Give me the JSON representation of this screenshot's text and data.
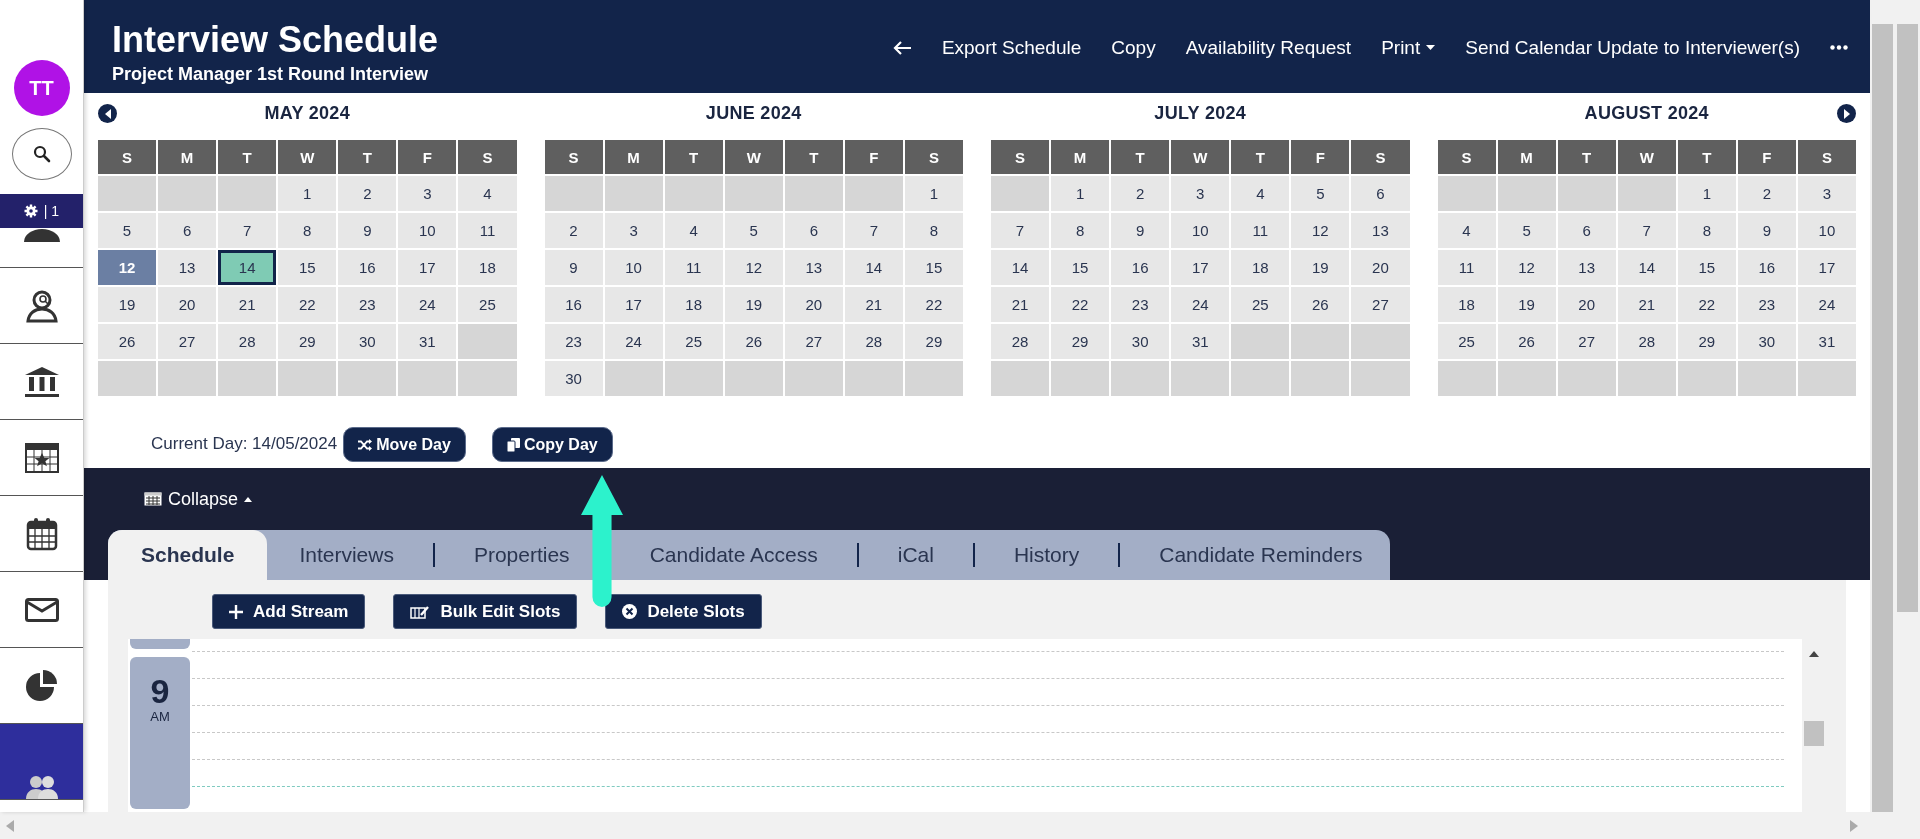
{
  "sidebar": {
    "avatar": "TT",
    "badge": "| 1",
    "items": [
      {
        "selected": false
      },
      {
        "selected": false
      },
      {
        "selected": false
      },
      {
        "selected": false
      },
      {
        "selected": false
      },
      {
        "selected": false
      },
      {
        "selected": false
      },
      {
        "selected": true
      }
    ]
  },
  "header": {
    "title": "Interview Schedule",
    "subtitle": "Project Manager 1st Round Interview",
    "actions": [
      {
        "kind": "back"
      },
      {
        "kind": "link",
        "label": "Export Schedule"
      },
      {
        "kind": "link",
        "label": "Copy"
      },
      {
        "kind": "link",
        "label": "Availability Request"
      },
      {
        "kind": "dropdown",
        "label": "Print"
      },
      {
        "kind": "link",
        "label": "Send Calendar Update to Interviewer(s)"
      },
      {
        "kind": "more"
      }
    ]
  },
  "calendar": {
    "months": [
      {
        "title": "MAY 2024",
        "weekdays": [
          "S",
          "M",
          "T",
          "W",
          "T",
          "F",
          "S"
        ],
        "weeks": [
          [
            {
              "kind": "blank"
            },
            {
              "kind": "blank"
            },
            {
              "kind": "blank"
            },
            {
              "kind": "day",
              "day": "1",
              "selected": false,
              "today": false
            },
            {
              "kind": "day",
              "day": "2",
              "selected": false,
              "today": false
            },
            {
              "kind": "day",
              "day": "3",
              "selected": false,
              "today": false
            },
            {
              "kind": "day",
              "day": "4",
              "selected": false,
              "today": false
            }
          ],
          [
            {
              "kind": "day",
              "day": "5",
              "selected": false,
              "today": false
            },
            {
              "kind": "day",
              "day": "6",
              "selected": false,
              "today": false
            },
            {
              "kind": "day",
              "day": "7",
              "selected": false,
              "today": false
            },
            {
              "kind": "day",
              "day": "8",
              "selected": false,
              "today": false
            },
            {
              "kind": "day",
              "day": "9",
              "selected": false,
              "today": false
            },
            {
              "kind": "day",
              "day": "10",
              "selected": false,
              "today": false
            },
            {
              "kind": "day",
              "day": "11",
              "selected": false,
              "today": false
            }
          ],
          [
            {
              "kind": "day",
              "day": "12",
              "selected": false,
              "today": true
            },
            {
              "kind": "day",
              "day": "13",
              "selected": false,
              "today": false
            },
            {
              "kind": "day",
              "day": "14",
              "selected": true,
              "today": false
            },
            {
              "kind": "day",
              "day": "15",
              "selected": false,
              "today": false
            },
            {
              "kind": "day",
              "day": "16",
              "selected": false,
              "today": false
            },
            {
              "kind": "day",
              "day": "17",
              "selected": false,
              "today": false
            },
            {
              "kind": "day",
              "day": "18",
              "selected": false,
              "today": false
            }
          ],
          [
            {
              "kind": "day",
              "day": "19",
              "selected": false,
              "today": false
            },
            {
              "kind": "day",
              "day": "20",
              "selected": false,
              "today": false
            },
            {
              "kind": "day",
              "day": "21",
              "selected": false,
              "today": false
            },
            {
              "kind": "day",
              "day": "22",
              "selected": false,
              "today": false
            },
            {
              "kind": "day",
              "day": "23",
              "selected": false,
              "today": false
            },
            {
              "kind": "day",
              "day": "24",
              "selected": false,
              "today": false
            },
            {
              "kind": "day",
              "day": "25",
              "selected": false,
              "today": false
            }
          ],
          [
            {
              "kind": "day",
              "day": "26",
              "selected": false,
              "today": false
            },
            {
              "kind": "day",
              "day": "27",
              "selected": false,
              "today": false
            },
            {
              "kind": "day",
              "day": "28",
              "selected": false,
              "today": false
            },
            {
              "kind": "day",
              "day": "29",
              "selected": false,
              "today": false
            },
            {
              "kind": "day",
              "day": "30",
              "selected": false,
              "today": false
            },
            {
              "kind": "day",
              "day": "31",
              "selected": false,
              "today": false
            },
            {
              "kind": "blank"
            }
          ],
          [
            {
              "kind": "blank"
            },
            {
              "kind": "blank"
            },
            {
              "kind": "blank"
            },
            {
              "kind": "blank"
            },
            {
              "kind": "blank"
            },
            {
              "kind": "blank"
            },
            {
              "kind": "blank"
            }
          ]
        ]
      },
      {
        "title": "JUNE 2024",
        "weekdays": [
          "S",
          "M",
          "T",
          "W",
          "T",
          "F",
          "S"
        ],
        "weeks": [
          [
            {
              "kind": "blank"
            },
            {
              "kind": "blank"
            },
            {
              "kind": "blank"
            },
            {
              "kind": "blank"
            },
            {
              "kind": "blank"
            },
            {
              "kind": "blank"
            },
            {
              "kind": "day",
              "day": "1",
              "selected": false,
              "today": false
            }
          ],
          [
            {
              "kind": "day",
              "day": "2",
              "selected": false,
              "today": false
            },
            {
              "kind": "day",
              "day": "3",
              "selected": false,
              "today": false
            },
            {
              "kind": "day",
              "day": "4",
              "selected": false,
              "today": false
            },
            {
              "kind": "day",
              "day": "5",
              "selected": false,
              "today": false
            },
            {
              "kind": "day",
              "day": "6",
              "selected": false,
              "today": false
            },
            {
              "kind": "day",
              "day": "7",
              "selected": false,
              "today": false
            },
            {
              "kind": "day",
              "day": "8",
              "selected": false,
              "today": false
            }
          ],
          [
            {
              "kind": "day",
              "day": "9",
              "selected": false,
              "today": false
            },
            {
              "kind": "day",
              "day": "10",
              "selected": false,
              "today": false
            },
            {
              "kind": "day",
              "day": "11",
              "selected": false,
              "today": false
            },
            {
              "kind": "day",
              "day": "12",
              "selected": false,
              "today": false
            },
            {
              "kind": "day",
              "day": "13",
              "selected": false,
              "today": false
            },
            {
              "kind": "day",
              "day": "14",
              "selected": false,
              "today": false
            },
            {
              "kind": "day",
              "day": "15",
              "selected": false,
              "today": false
            }
          ],
          [
            {
              "kind": "day",
              "day": "16",
              "selected": false,
              "today": false
            },
            {
              "kind": "day",
              "day": "17",
              "selected": false,
              "today": false
            },
            {
              "kind": "day",
              "day": "18",
              "selected": false,
              "today": false
            },
            {
              "kind": "day",
              "day": "19",
              "selected": false,
              "today": false
            },
            {
              "kind": "day",
              "day": "20",
              "selected": false,
              "today": false
            },
            {
              "kind": "day",
              "day": "21",
              "selected": false,
              "today": false
            },
            {
              "kind": "day",
              "day": "22",
              "selected": false,
              "today": false
            }
          ],
          [
            {
              "kind": "day",
              "day": "23",
              "selected": false,
              "today": false
            },
            {
              "kind": "day",
              "day": "24",
              "selected": false,
              "today": false
            },
            {
              "kind": "day",
              "day": "25",
              "selected": false,
              "today": false
            },
            {
              "kind": "day",
              "day": "26",
              "selected": false,
              "today": false
            },
            {
              "kind": "day",
              "day": "27",
              "selected": false,
              "today": false
            },
            {
              "kind": "day",
              "day": "28",
              "selected": false,
              "today": false
            },
            {
              "kind": "day",
              "day": "29",
              "selected": false,
              "today": false
            }
          ],
          [
            {
              "kind": "day",
              "day": "30",
              "selected": false,
              "today": false
            },
            {
              "kind": "blank"
            },
            {
              "kind": "blank"
            },
            {
              "kind": "blank"
            },
            {
              "kind": "blank"
            },
            {
              "kind": "blank"
            },
            {
              "kind": "blank"
            }
          ]
        ]
      },
      {
        "title": "JULY 2024",
        "weekdays": [
          "S",
          "M",
          "T",
          "W",
          "T",
          "F",
          "S"
        ],
        "weeks": [
          [
            {
              "kind": "blank"
            },
            {
              "kind": "day",
              "day": "1",
              "selected": false,
              "today": false
            },
            {
              "kind": "day",
              "day": "2",
              "selected": false,
              "today": false
            },
            {
              "kind": "day",
              "day": "3",
              "selected": false,
              "today": false
            },
            {
              "kind": "day",
              "day": "4",
              "selected": false,
              "today": false
            },
            {
              "kind": "day",
              "day": "5",
              "selected": false,
              "today": false
            },
            {
              "kind": "day",
              "day": "6",
              "selected": false,
              "today": false
            }
          ],
          [
            {
              "kind": "day",
              "day": "7",
              "selected": false,
              "today": false
            },
            {
              "kind": "day",
              "day": "8",
              "selected": false,
              "today": false
            },
            {
              "kind": "day",
              "day": "9",
              "selected": false,
              "today": false
            },
            {
              "kind": "day",
              "day": "10",
              "selected": false,
              "today": false
            },
            {
              "kind": "day",
              "day": "11",
              "selected": false,
              "today": false
            },
            {
              "kind": "day",
              "day": "12",
              "selected": false,
              "today": false
            },
            {
              "kind": "day",
              "day": "13",
              "selected": false,
              "today": false
            }
          ],
          [
            {
              "kind": "day",
              "day": "14",
              "selected": false,
              "today": false
            },
            {
              "kind": "day",
              "day": "15",
              "selected": false,
              "today": false
            },
            {
              "kind": "day",
              "day": "16",
              "selected": false,
              "today": false
            },
            {
              "kind": "day",
              "day": "17",
              "selected": false,
              "today": false
            },
            {
              "kind": "day",
              "day": "18",
              "selected": false,
              "today": false
            },
            {
              "kind": "day",
              "day": "19",
              "selected": false,
              "today": false
            },
            {
              "kind": "day",
              "day": "20",
              "selected": false,
              "today": false
            }
          ],
          [
            {
              "kind": "day",
              "day": "21",
              "selected": false,
              "today": false
            },
            {
              "kind": "day",
              "day": "22",
              "selected": false,
              "today": false
            },
            {
              "kind": "day",
              "day": "23",
              "selected": false,
              "today": false
            },
            {
              "kind": "day",
              "day": "24",
              "selected": false,
              "today": false
            },
            {
              "kind": "day",
              "day": "25",
              "selected": false,
              "today": false
            },
            {
              "kind": "day",
              "day": "26",
              "selected": false,
              "today": false
            },
            {
              "kind": "day",
              "day": "27",
              "selected": false,
              "today": false
            }
          ],
          [
            {
              "kind": "day",
              "day": "28",
              "selected": false,
              "today": false
            },
            {
              "kind": "day",
              "day": "29",
              "selected": false,
              "today": false
            },
            {
              "kind": "day",
              "day": "30",
              "selected": false,
              "today": false
            },
            {
              "kind": "day",
              "day": "31",
              "selected": false,
              "today": false
            },
            {
              "kind": "blank"
            },
            {
              "kind": "blank"
            },
            {
              "kind": "blank"
            }
          ],
          [
            {
              "kind": "blank"
            },
            {
              "kind": "blank"
            },
            {
              "kind": "blank"
            },
            {
              "kind": "blank"
            },
            {
              "kind": "blank"
            },
            {
              "kind": "blank"
            },
            {
              "kind": "blank"
            }
          ]
        ]
      },
      {
        "title": "AUGUST 2024",
        "weekdays": [
          "S",
          "M",
          "T",
          "W",
          "T",
          "F",
          "S"
        ],
        "weeks": [
          [
            {
              "kind": "blank"
            },
            {
              "kind": "blank"
            },
            {
              "kind": "blank"
            },
            {
              "kind": "blank"
            },
            {
              "kind": "day",
              "day": "1",
              "selected": false,
              "today": false
            },
            {
              "kind": "day",
              "day": "2",
              "selected": false,
              "today": false
            },
            {
              "kind": "day",
              "day": "3",
              "selected": false,
              "today": false
            }
          ],
          [
            {
              "kind": "day",
              "day": "4",
              "selected": false,
              "today": false
            },
            {
              "kind": "day",
              "day": "5",
              "selected": false,
              "today": false
            },
            {
              "kind": "day",
              "day": "6",
              "selected": false,
              "today": false
            },
            {
              "kind": "day",
              "day": "7",
              "selected": false,
              "today": false
            },
            {
              "kind": "day",
              "day": "8",
              "selected": false,
              "today": false
            },
            {
              "kind": "day",
              "day": "9",
              "selected": false,
              "today": false
            },
            {
              "kind": "day",
              "day": "10",
              "selected": false,
              "today": false
            }
          ],
          [
            {
              "kind": "day",
              "day": "11",
              "selected": false,
              "today": false
            },
            {
              "kind": "day",
              "day": "12",
              "selected": false,
              "today": false
            },
            {
              "kind": "day",
              "day": "13",
              "selected": false,
              "today": false
            },
            {
              "kind": "day",
              "day": "14",
              "selected": false,
              "today": false
            },
            {
              "kind": "day",
              "day": "15",
              "selected": false,
              "today": false
            },
            {
              "kind": "day",
              "day": "16",
              "selected": false,
              "today": false
            },
            {
              "kind": "day",
              "day": "17",
              "selected": false,
              "today": false
            }
          ],
          [
            {
              "kind": "day",
              "day": "18",
              "selected": false,
              "today": false
            },
            {
              "kind": "day",
              "day": "19",
              "selected": false,
              "today": false
            },
            {
              "kind": "day",
              "day": "20",
              "selected": false,
              "today": false
            },
            {
              "kind": "day",
              "day": "21",
              "selected": false,
              "today": false
            },
            {
              "kind": "day",
              "day": "22",
              "selected": false,
              "today": false
            },
            {
              "kind": "day",
              "day": "23",
              "selected": false,
              "today": false
            },
            {
              "kind": "day",
              "day": "24",
              "selected": false,
              "today": false
            }
          ],
          [
            {
              "kind": "day",
              "day": "25",
              "selected": false,
              "today": false
            },
            {
              "kind": "day",
              "day": "26",
              "selected": false,
              "today": false
            },
            {
              "kind": "day",
              "day": "27",
              "selected": false,
              "today": false
            },
            {
              "kind": "day",
              "day": "28",
              "selected": false,
              "today": false
            },
            {
              "kind": "day",
              "day": "29",
              "selected": false,
              "today": false
            },
            {
              "kind": "day",
              "day": "30",
              "selected": false,
              "today": false
            },
            {
              "kind": "day",
              "day": "31",
              "selected": false,
              "today": false
            }
          ],
          [
            {
              "kind": "blank"
            },
            {
              "kind": "blank"
            },
            {
              "kind": "blank"
            },
            {
              "kind": "blank"
            },
            {
              "kind": "blank"
            },
            {
              "kind": "blank"
            },
            {
              "kind": "blank"
            }
          ]
        ]
      }
    ]
  },
  "day_bar": {
    "current_day": "Current Day: 14/05/2024",
    "buttons": [
      {
        "kind": "move",
        "label": "Move Day"
      },
      {
        "kind": "copy",
        "label": "Copy Day"
      }
    ]
  },
  "collapse": {
    "label": "Collapse"
  },
  "tabs": [
    {
      "label": "Schedule",
      "selected": true
    },
    {
      "label": "Interviews",
      "selected": false
    },
    {
      "label": "Properties",
      "selected": false
    },
    {
      "label": "Candidate Access",
      "selected": false
    },
    {
      "label": "iCal",
      "selected": false
    },
    {
      "label": "History",
      "selected": false
    },
    {
      "label": "Candidate Reminders",
      "selected": false
    }
  ],
  "toolbar": [
    {
      "kind": "add",
      "label": "Add Stream"
    },
    {
      "kind": "edit",
      "label": "Bulk Edit Slots"
    },
    {
      "kind": "delete",
      "label": "Delete Slots"
    }
  ],
  "schedule": {
    "hour": "9",
    "period": "AM"
  }
}
